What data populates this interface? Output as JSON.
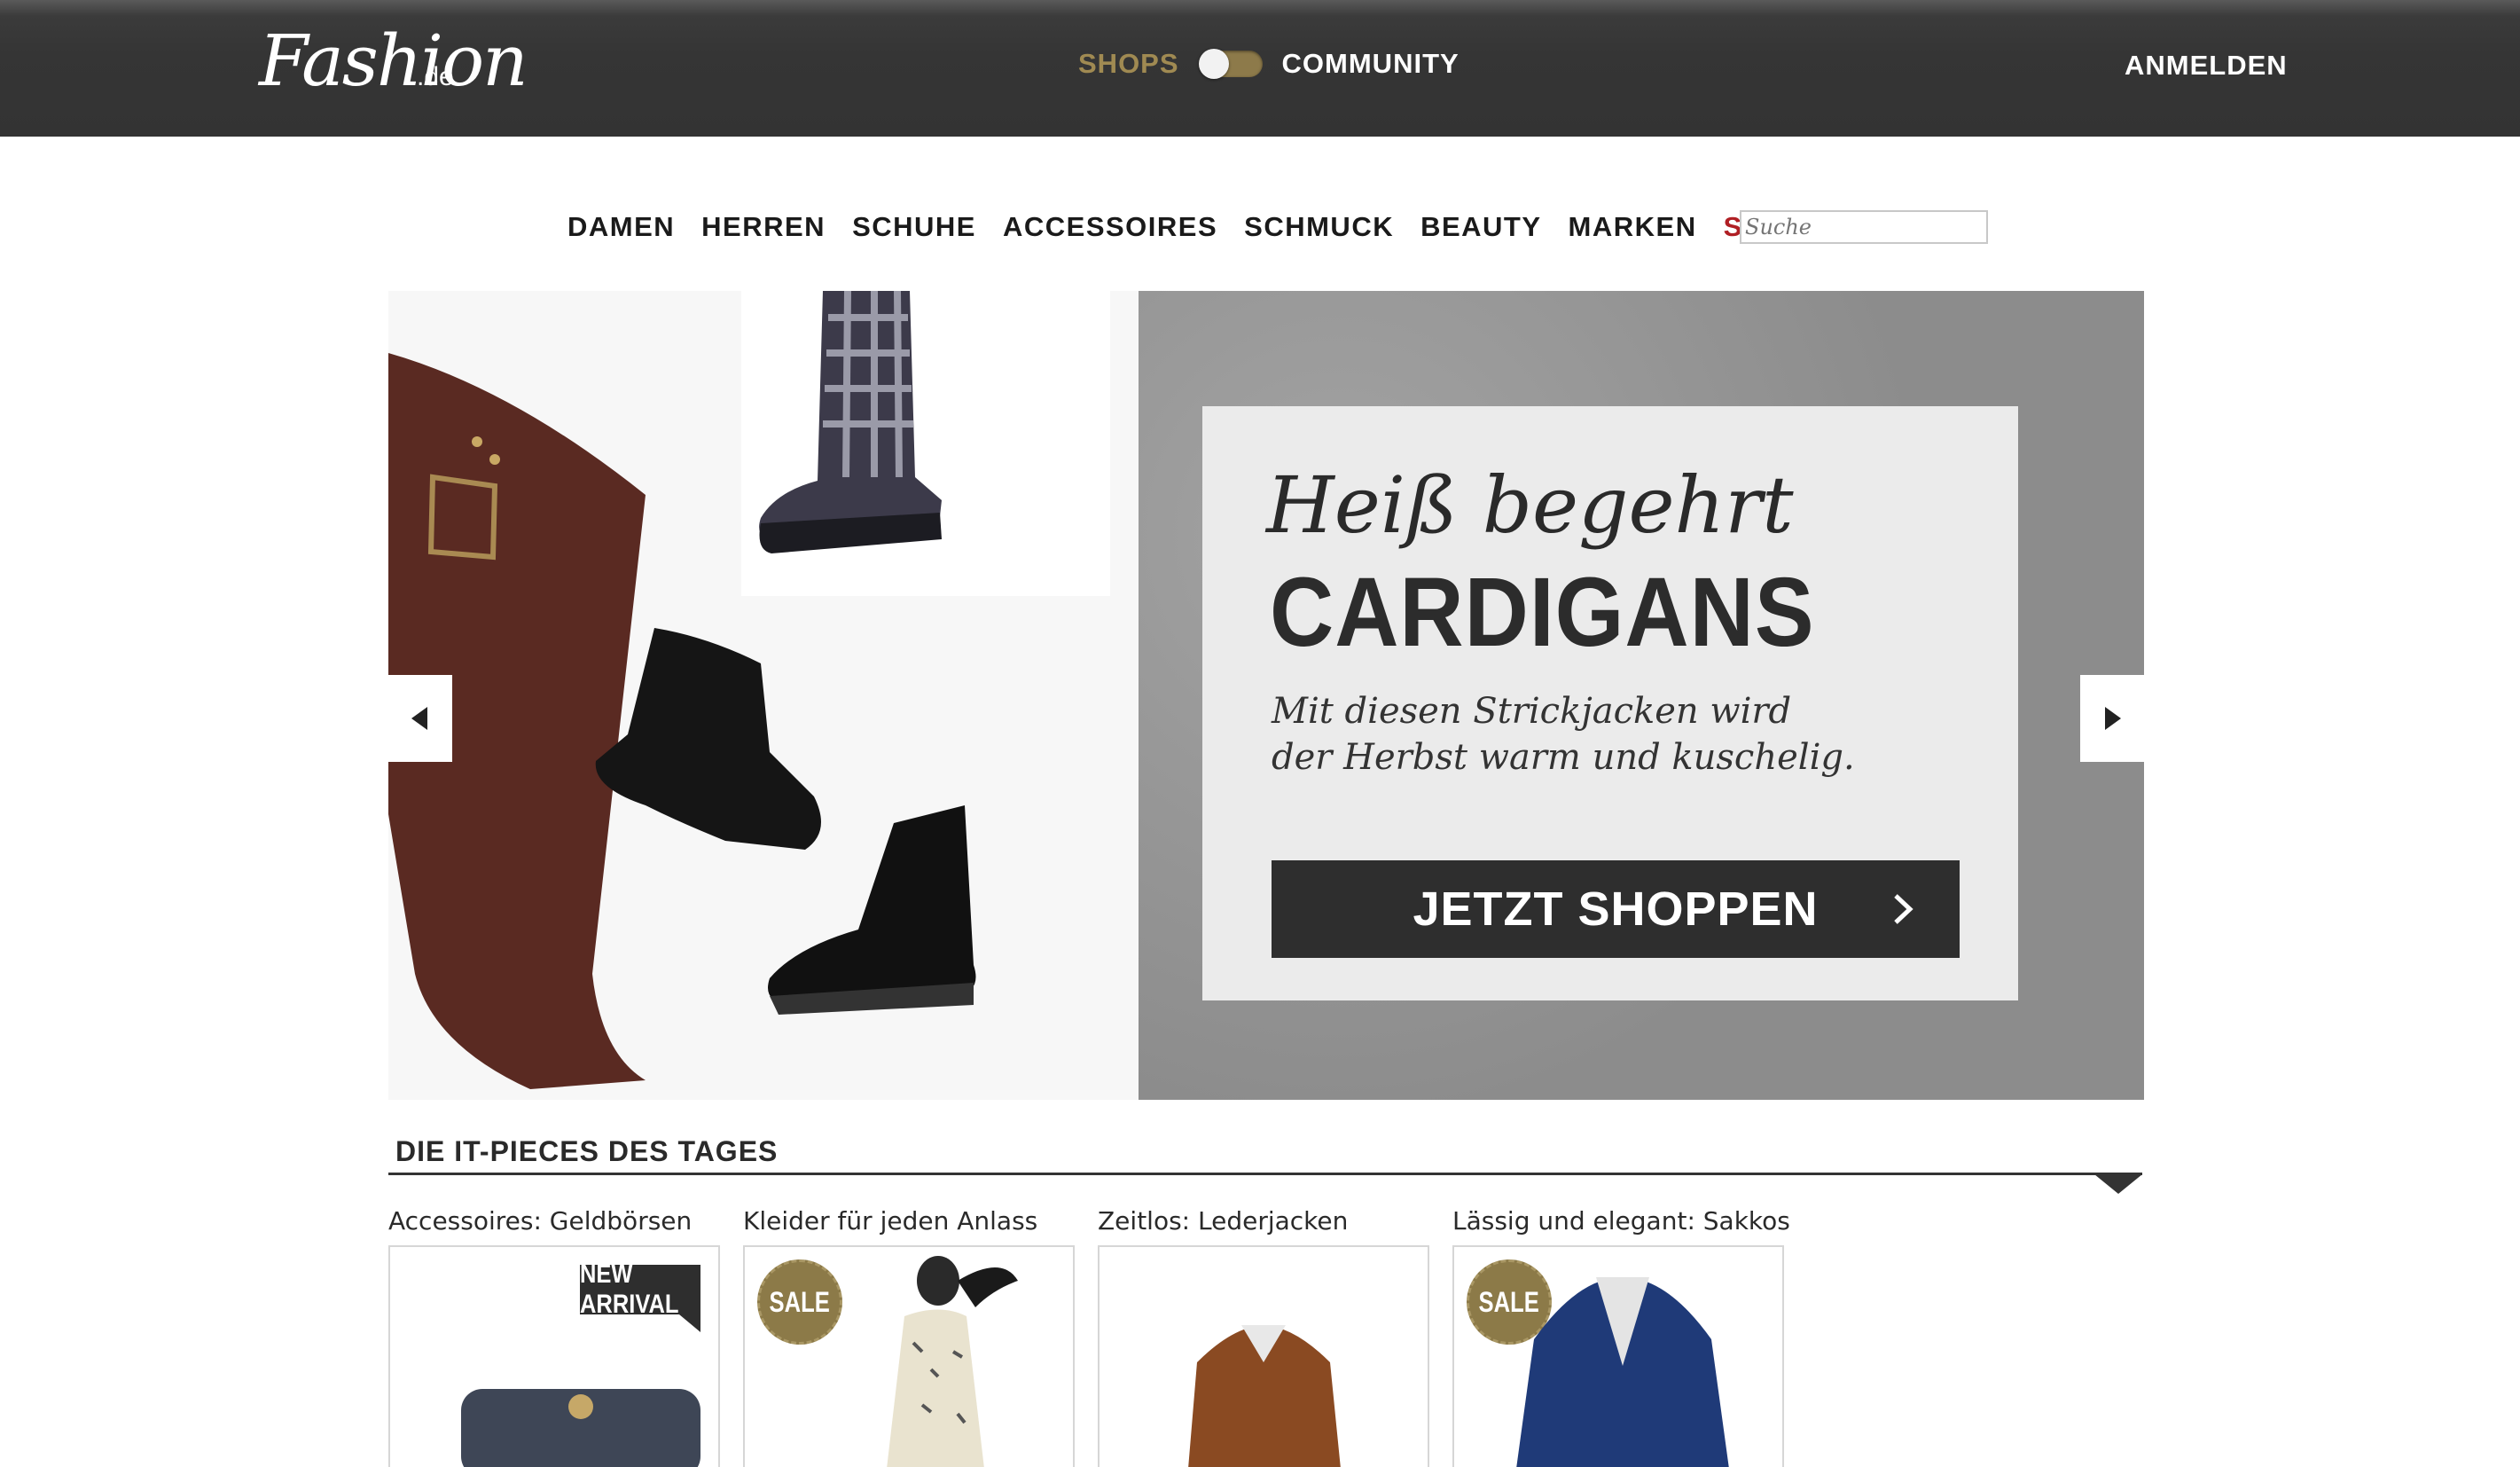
{
  "header": {
    "logo_text": "Fashion",
    "logo_suffix": ".de",
    "switch_left": "SHOPS",
    "switch_right": "COMMUNITY",
    "login": "ANMELDEN"
  },
  "nav": {
    "items": [
      "DAMEN",
      "HERREN",
      "SCHUHE",
      "ACCESSOIRES",
      "SCHMUCK",
      "BEAUTY",
      "MARKEN",
      "SALE"
    ],
    "search_placeholder": "Suche"
  },
  "hero": {
    "kicker": "Heiß begehrt",
    "title": "CARDIGANS",
    "text_line1": "Mit diesen Strickjacken wird",
    "text_line2": "der Herbst warm und kuschelig.",
    "cta": "JETZT SHOPPEN"
  },
  "section": {
    "title": "DIE IT-PIECES DES TAGES"
  },
  "cards": [
    {
      "label": "Accessoires: Geldbörsen",
      "badge": "NEW ARRIVAL"
    },
    {
      "label": "Kleider für jeden Anlass",
      "badge": "SALE"
    },
    {
      "label": "Zeitlos: Lederjacken",
      "badge": ""
    },
    {
      "label": "Lässig und elegant: Sakkos",
      "badge": "SALE"
    }
  ],
  "colors": {
    "topbar": "#333333",
    "gold": "#a08a52",
    "sale_red": "#b01f24",
    "cta_dark": "#2e2e2e"
  }
}
